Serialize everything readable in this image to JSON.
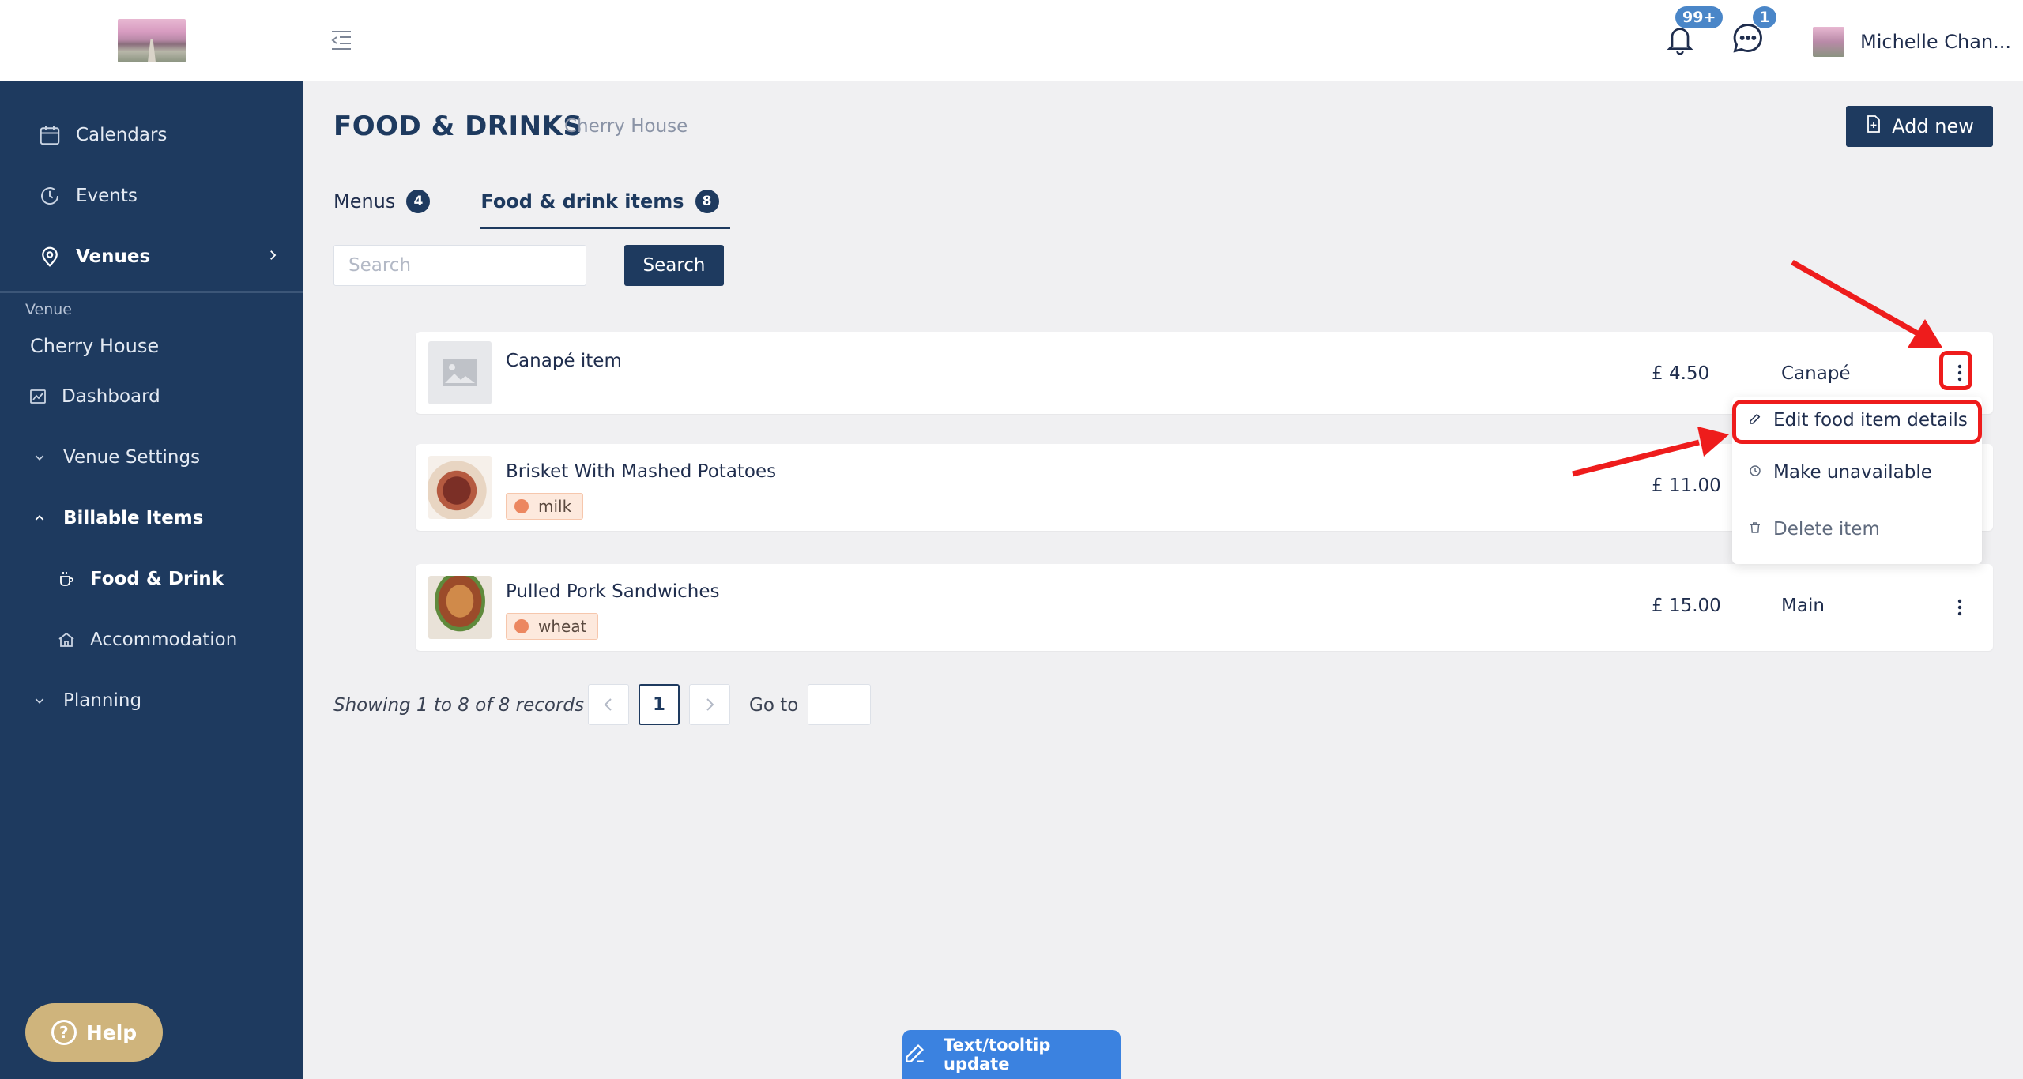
{
  "sidebar": {
    "nav": [
      {
        "label": "Calendars",
        "icon": "calendar-icon"
      },
      {
        "label": "Events",
        "icon": "clock-icon"
      },
      {
        "label": "Venues",
        "icon": "map-pin-icon"
      }
    ],
    "venue_label": "Venue",
    "venue_name": "Cherry House",
    "items": [
      {
        "label": "Dashboard",
        "icon": "chart-icon"
      },
      {
        "label": "Venue Settings",
        "icon": "chevron-down-icon"
      },
      {
        "label": "Billable Items",
        "icon": "chevron-up-icon"
      },
      {
        "label": "Food & Drink",
        "icon": "coffee-cup-icon"
      },
      {
        "label": "Accommodation",
        "icon": "house-icon"
      },
      {
        "label": "Planning",
        "icon": "chevron-down-icon"
      }
    ],
    "help_label": "Help"
  },
  "topbar": {
    "notifications_badge": "99+",
    "messages_badge": "1",
    "user_name": "Michelle Chan..."
  },
  "page": {
    "title": "FOOD & DRINKS",
    "subtitle": "Cherry House",
    "add_label": "Add new"
  },
  "tabs": [
    {
      "label": "Menus",
      "count": "4"
    },
    {
      "label": "Food & drink items",
      "count": "8"
    }
  ],
  "search": {
    "placeholder": "Search",
    "button_label": "Search"
  },
  "items": [
    {
      "name": "Canapé item",
      "price": "£ 4.50",
      "category": "Canapé",
      "allergen": ""
    },
    {
      "name": "Brisket With Mashed Potatoes",
      "price": "£ 11.00",
      "category": "",
      "allergen": "milk"
    },
    {
      "name": "Pulled Pork Sandwiches",
      "price": "£ 15.00",
      "category": "Main",
      "allergen": "wheat"
    }
  ],
  "dropdown": {
    "edit": "Edit food item details",
    "unavailable": "Make unavailable",
    "delete": "Delete item"
  },
  "pagination": {
    "summary": "Showing 1 to 8 of 8 records",
    "current_page": "1",
    "goto_label": "Go to"
  },
  "tooltip_button": "Text/tooltip update",
  "colors": {
    "sidebar_bg": "#1e3a5f",
    "accent": "#1e3a5f",
    "annotation_red": "#ee1c1c",
    "help_gold": "#cfb47c"
  }
}
